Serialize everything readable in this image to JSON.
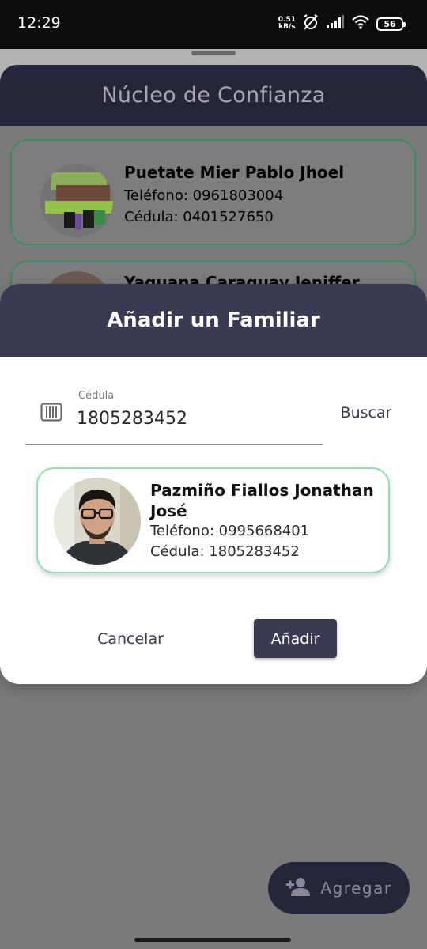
{
  "status_bar": {
    "time": "12:29",
    "net_speed_value": "0.51",
    "net_speed_unit": "kB/s",
    "battery": "56"
  },
  "background": {
    "title": "Núcleo de Confianza",
    "contacts": [
      {
        "name": "Puetate Mier Pablo Jhoel",
        "phone": "Teléfono: 0961803004",
        "cedula": "Cédula: 0401527650"
      },
      {
        "name": "Yaguana Caraguay Jeniffer"
      }
    ],
    "fab": {
      "label": "Agregar",
      "icon": "add-person-icon"
    }
  },
  "dialog": {
    "title": "Añadir un Familiar",
    "field": {
      "label": "Cédula",
      "value": "1805283452",
      "icon": "barcode-icon"
    },
    "search_label": "Buscar",
    "result": {
      "name": "Pazmiño Fiallos Jonathan José",
      "phone": "Teléfono: 0995668401",
      "cedula": "Cédula: 1805283452"
    },
    "cancel_label": "Cancelar",
    "add_label": "Añadir"
  },
  "colors": {
    "primary_dark": "#3a3a52",
    "card_border_green": "#8fe0b0",
    "scrim": "#7a7a7a"
  }
}
